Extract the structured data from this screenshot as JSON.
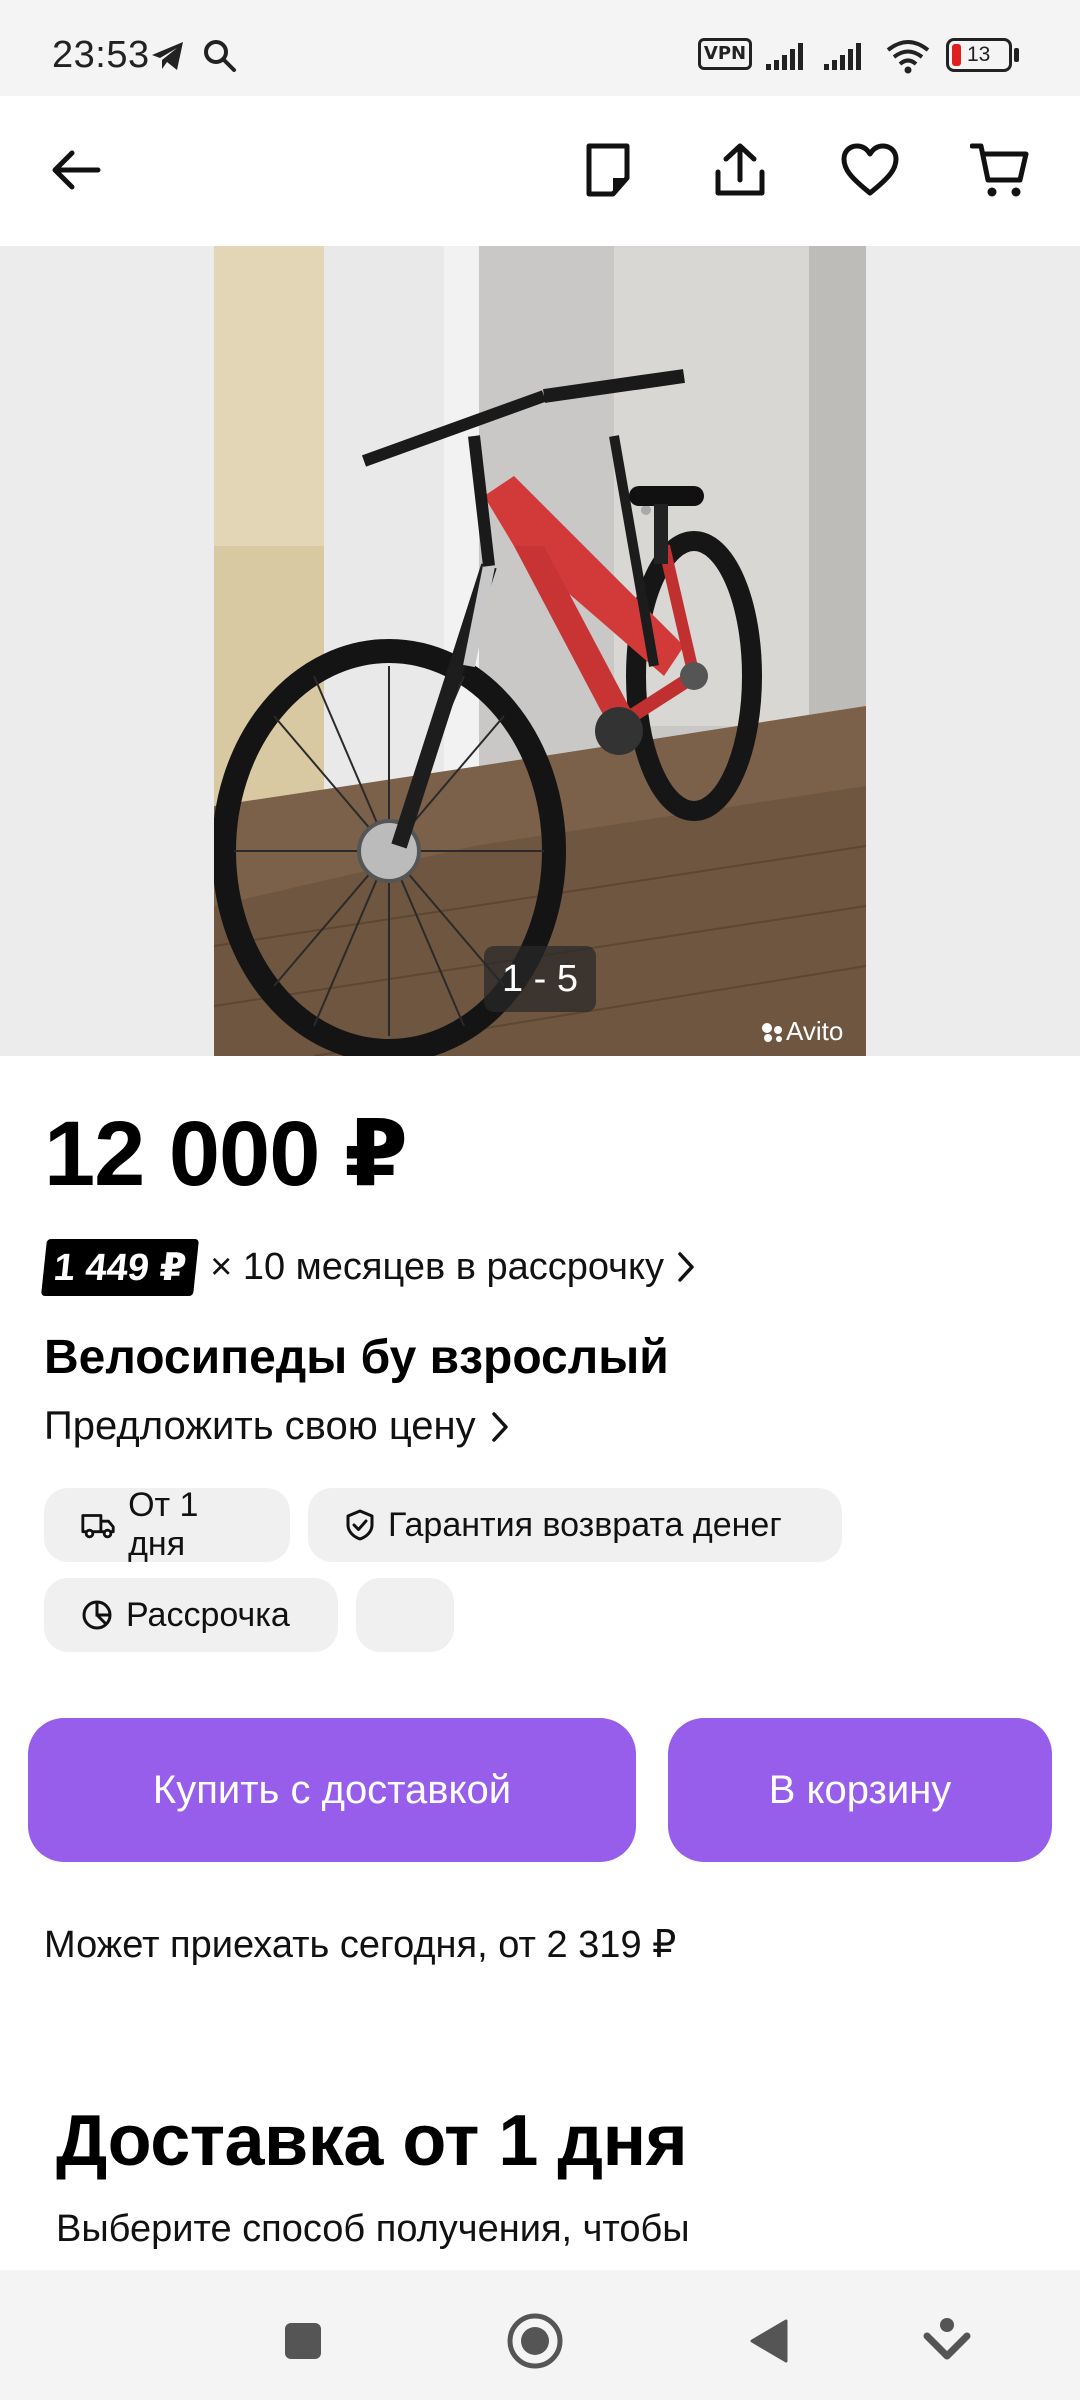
{
  "status_bar": {
    "time": "23:53",
    "vpn_label": "VPN",
    "battery_level": "13",
    "icons": [
      "telegram-icon",
      "search-icon",
      "vpn-icon",
      "signal-icon",
      "signal-icon",
      "wifi-icon",
      "battery-icon"
    ]
  },
  "toolbar": {
    "icons": [
      "back-arrow-icon",
      "note-icon",
      "share-icon",
      "heart-icon",
      "cart-icon"
    ]
  },
  "gallery": {
    "counter": "1 - 5",
    "watermark": "Avito"
  },
  "listing": {
    "price": "12 000 ₽",
    "installment_amount": "1 449 ₽",
    "installment_text": "× 10 месяцев в рассрочку",
    "title": "Велосипеды бу взрослый",
    "offer_price_link": "Предложить свою цену"
  },
  "chips": [
    {
      "label": "От 1 дня",
      "icon": "truck-icon"
    },
    {
      "label": "Гарантия возврата денег",
      "icon": "shield-check-icon"
    },
    {
      "label": "Рассрочка",
      "icon": "pie-chart-icon"
    },
    {
      "label": "",
      "icon": ""
    }
  ],
  "actions": {
    "buy_with_delivery": "Купить с доставкой",
    "add_to_cart": "В корзину"
  },
  "delivery": {
    "arrival_note": "Может приехать сегодня, от 2 319 ₽",
    "heading": "Доставка от 1 дня",
    "subtext": "Выберите способ получения, чтобы"
  },
  "colors": {
    "accent": "#965eeb",
    "chip_bg": "#f0f0f0",
    "battery_low": "#e02020"
  }
}
